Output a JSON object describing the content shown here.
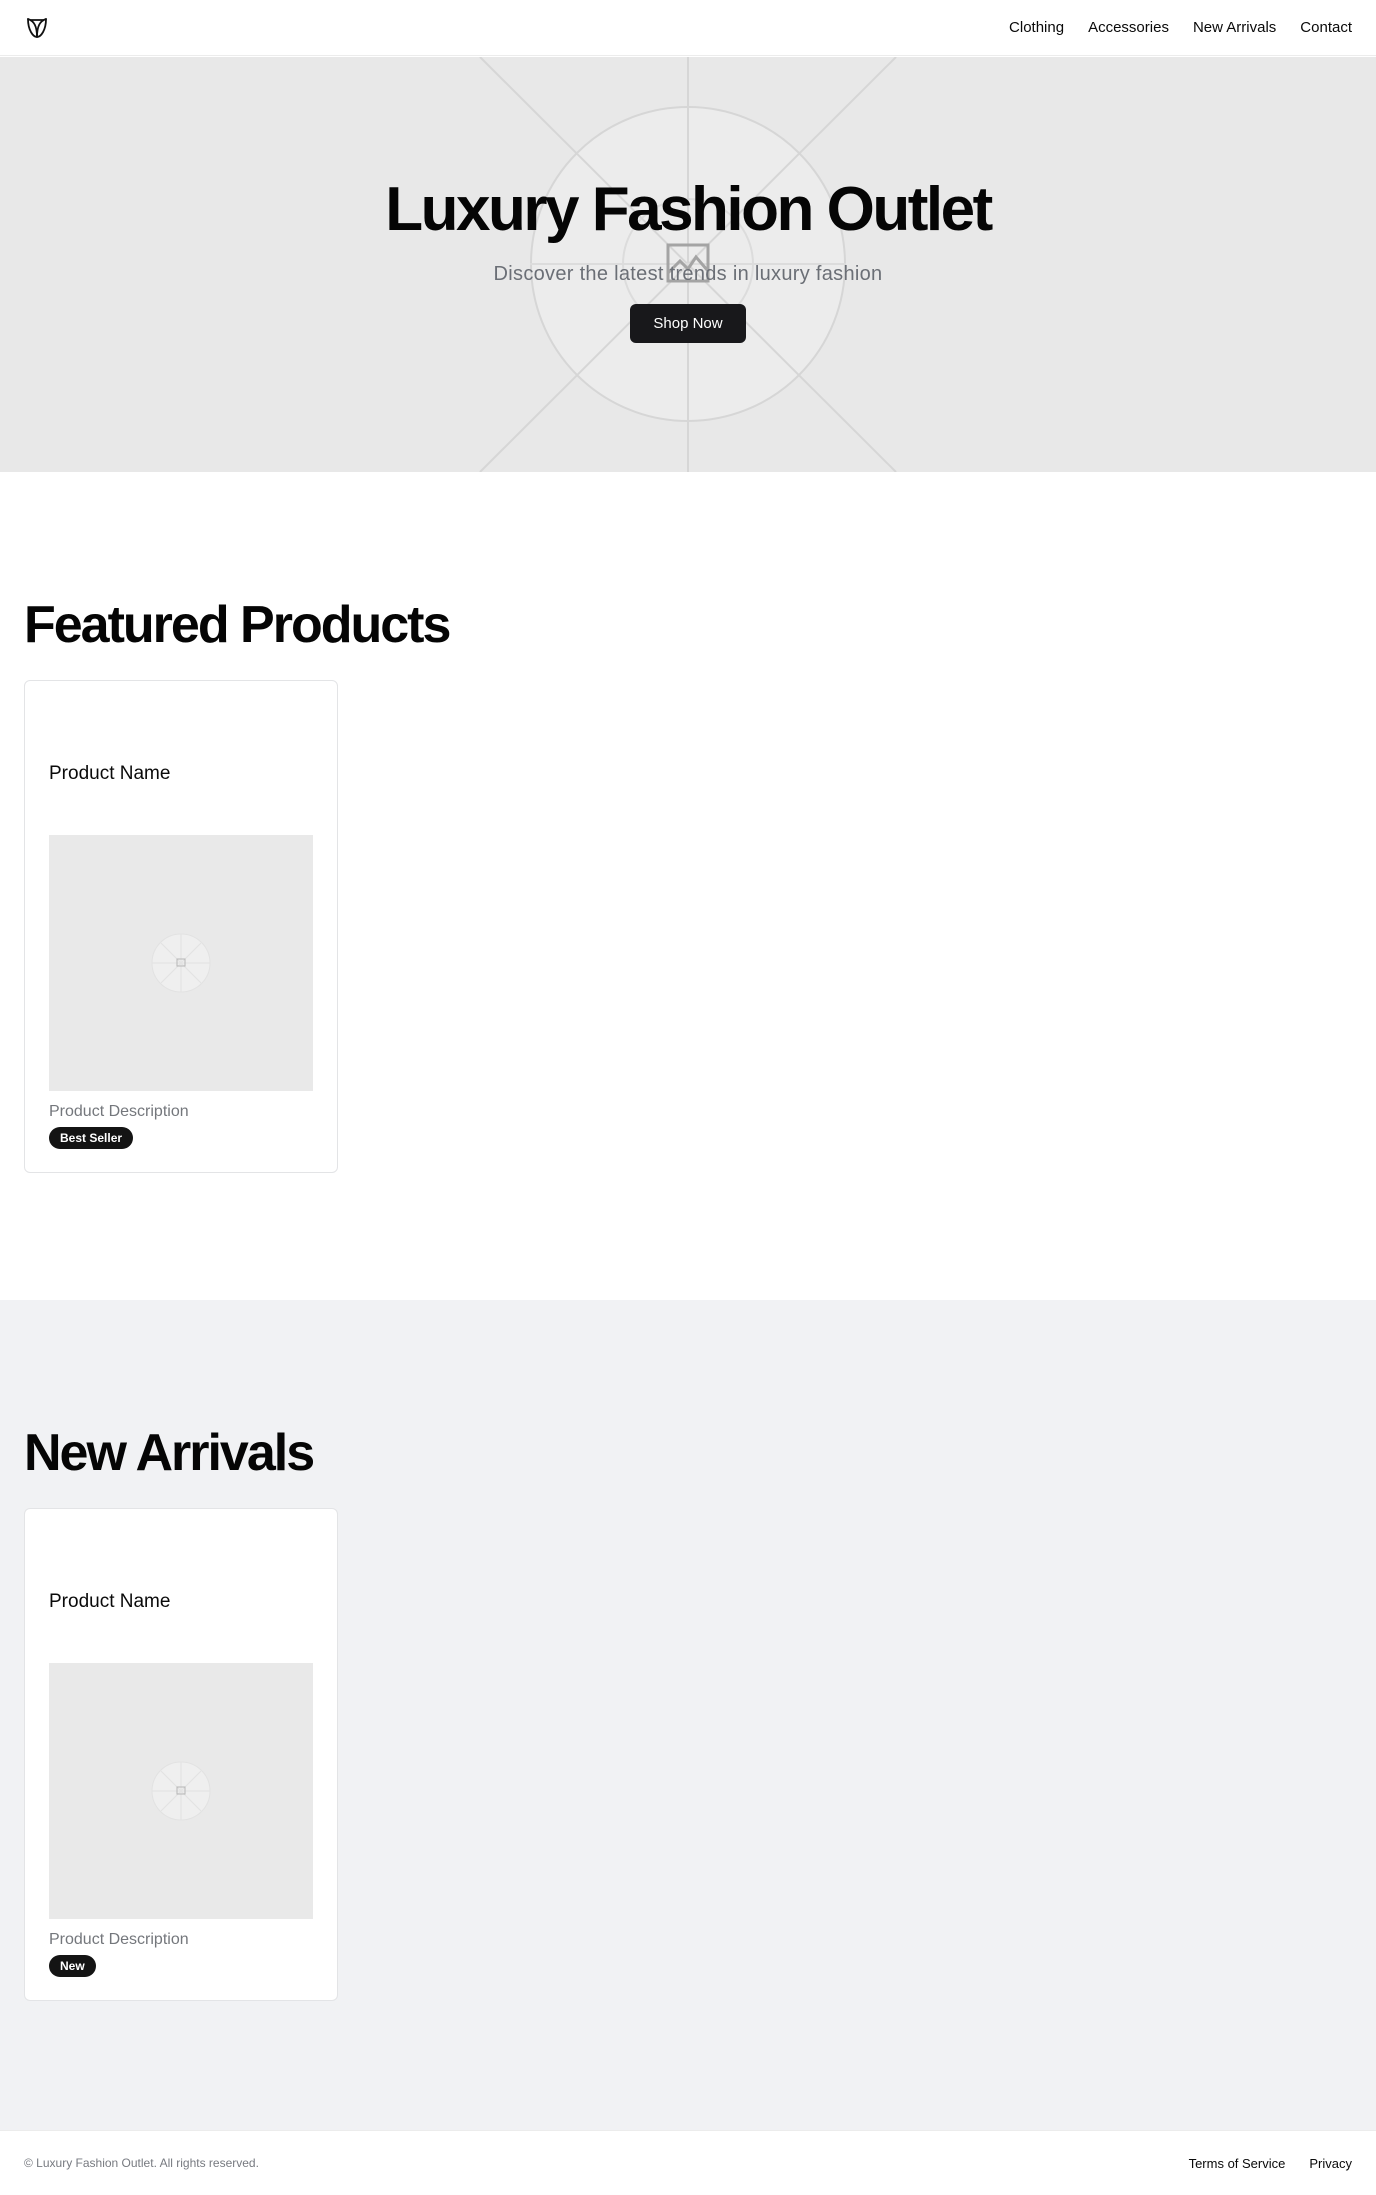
{
  "header": {
    "logo_icon": "leaf-v-logo-icon",
    "nav": [
      {
        "label": "Clothing"
      },
      {
        "label": "Accessories"
      },
      {
        "label": "New Arrivals"
      },
      {
        "label": "Contact"
      }
    ]
  },
  "hero": {
    "title": "Luxury Fashion Outlet",
    "subtitle": "Discover the latest trends in luxury fashion",
    "cta_label": "Shop Now",
    "image_icon": "image-placeholder-icon",
    "background_color": "#e8e8e8"
  },
  "featured": {
    "title": "Featured Products",
    "products": [
      {
        "name": "Product Name",
        "description": "Product Description",
        "badge": "Best Seller"
      }
    ]
  },
  "arrivals": {
    "title": "New Arrivals",
    "products": [
      {
        "name": "Product Name",
        "description": "Product Description",
        "badge": "New"
      }
    ]
  },
  "footer": {
    "copyright": "© Luxury Fashion Outlet. All rights reserved.",
    "links": [
      {
        "label": "Terms of Service"
      },
      {
        "label": "Privacy"
      }
    ]
  },
  "colors": {
    "accent": "#18181b",
    "alt_section_bg": "#f1f2f4",
    "muted_text": "#6b6f76"
  }
}
